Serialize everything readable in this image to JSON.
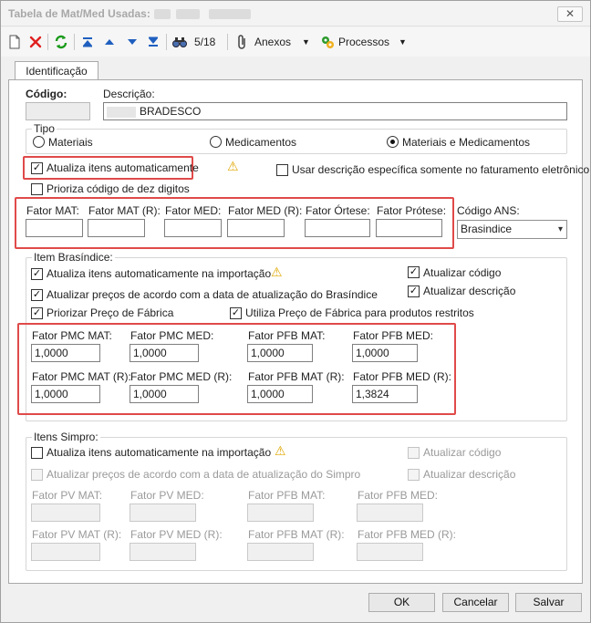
{
  "window": {
    "title": "Tabela de Mat/Med Usadas:",
    "close_glyph": "✕"
  },
  "toolbar": {
    "record_position": "5/18",
    "anexos_label": "Anexos",
    "processos_label": "Processos",
    "icons": [
      "new-document-icon",
      "delete-icon",
      "refresh-icon",
      "first-record-icon",
      "previous-record-icon",
      "next-record-icon",
      "last-record-icon",
      "binoculars-icon",
      "attachment-icon",
      "process-icon"
    ]
  },
  "tabs": [
    {
      "label": "Identificação"
    }
  ],
  "identificacao": {
    "codigo_label": "Código:",
    "codigo_value": "",
    "descricao_label": "Descrição:",
    "descricao_value": "BRADESCO",
    "tipo": {
      "label": "Tipo",
      "options": [
        "Materiais",
        "Medicamentos",
        "Materiais e Medicamentos"
      ],
      "selected": "Materiais e Medicamentos"
    },
    "atualiza_itens_label": "Atualiza itens automaticamente",
    "atualiza_itens_checked": true,
    "usar_descricao_label": "Usar descrição específica somente no faturamento eletrônico",
    "usar_descricao_checked": false,
    "prioriza_codigo_label": "Prioriza código de dez digitos",
    "prioriza_codigo_checked": false,
    "fatores": {
      "mat_label": "Fator MAT:",
      "mat_r_label": "Fator MAT (R):",
      "med_label": "Fator MED:",
      "med_r_label": "Fator MED (R):",
      "ortese_label": "Fator Órtese:",
      "protese_label": "Fator Prótese:"
    },
    "codigo_ans_label": "Código ANS:",
    "codigo_ans_value": "Brasindice"
  },
  "brasindice": {
    "label": "Item Brasíndice:",
    "atualiza_importacao_label": "Atualiza itens automaticamente na importação",
    "atualiza_importacao_checked": true,
    "atualizar_codigo_label": "Atualizar código",
    "atualizar_codigo_checked": true,
    "atualizar_precos_label": "Atualizar preços de acordo com a data de atualização do Brasíndice",
    "atualizar_precos_checked": true,
    "atualizar_descricao_label": "Atualizar descrição",
    "atualizar_descricao_checked": true,
    "priorizar_preco_label": "Priorizar Preço de Fábrica",
    "priorizar_preco_checked": true,
    "utiliza_preco_label": "Utiliza Preço de Fábrica para produtos restritos",
    "utiliza_preco_checked": true,
    "pmc_mat_label": "Fator PMC MAT:",
    "pmc_mat_value": "1,0000",
    "pmc_med_label": "Fator PMC MED:",
    "pmc_med_value": "1,0000",
    "pfb_mat_label": "Fator PFB MAT:",
    "pfb_mat_value": "1,0000",
    "pfb_med_label": "Fator PFB MED:",
    "pfb_med_value": "1,0000",
    "pmc_mat_r_label": "Fator PMC MAT (R):",
    "pmc_mat_r_value": "1,0000",
    "pmc_med_r_label": "Fator PMC MED (R):",
    "pmc_med_r_value": "1,0000",
    "pfb_mat_r_label": "Fator PFB MAT (R):",
    "pfb_mat_r_value": "1,0000",
    "pfb_med_r_label": "Fator PFB MED (R):",
    "pfb_med_r_value": "1,3824"
  },
  "simpro": {
    "label": "Itens Simpro:",
    "atualiza_importacao_label": "Atualiza itens automaticamente na importação",
    "atualizar_codigo_label": "Atualizar código",
    "atualizar_precos_label": "Atualizar preços de acordo com a data de atualização do Simpro",
    "atualizar_descricao_label": "Atualizar descrição",
    "pv_mat_label": "Fator PV MAT:",
    "pv_med_label": "Fator PV MED:",
    "pfb_mat_label": "Fator PFB MAT:",
    "pfb_med_label": "Fator PFB MED:",
    "pv_mat_r_label": "Fator PV MAT (R):",
    "pv_med_r_label": "Fator PV MED (R):",
    "pfb_mat_r_label": "Fator PFB MAT (R):",
    "pfb_med_r_label": "Fator PFB MED (R):"
  },
  "footer": {
    "ok_label": "OK",
    "cancelar_label": "Cancelar",
    "salvar_label": "Salvar"
  }
}
